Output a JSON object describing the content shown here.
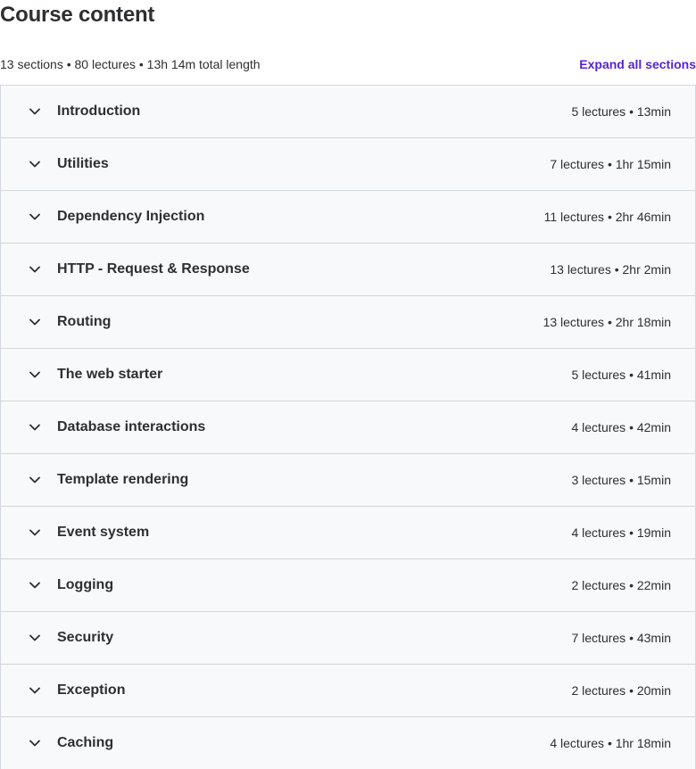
{
  "header": {
    "title": "Course content",
    "summary": "13 sections • 80 lectures • 13h 14m total length",
    "expand_all_label": "Expand all sections"
  },
  "icons": {
    "section_toggle": "chevron-down-icon"
  },
  "colors": {
    "accent": "#5624d0",
    "text": "#2d2f31",
    "row_background": "#f7f9fa",
    "border": "#d1d7dc"
  },
  "sections": [
    {
      "title": "Introduction",
      "info": "5 lectures • 13min"
    },
    {
      "title": "Utilities",
      "info": "7 lectures • 1hr 15min"
    },
    {
      "title": "Dependency Injection",
      "info": "11 lectures • 2hr 46min"
    },
    {
      "title": "HTTP - Request & Response",
      "info": "13 lectures • 2hr 2min"
    },
    {
      "title": "Routing",
      "info": "13 lectures • 2hr 18min"
    },
    {
      "title": "The web starter",
      "info": "5 lectures • 41min"
    },
    {
      "title": "Database interactions",
      "info": "4 lectures • 42min"
    },
    {
      "title": "Template rendering",
      "info": "3 lectures • 15min"
    },
    {
      "title": "Event system",
      "info": "4 lectures • 19min"
    },
    {
      "title": "Logging",
      "info": "2 lectures • 22min"
    },
    {
      "title": "Security",
      "info": "7 lectures • 43min"
    },
    {
      "title": "Exception",
      "info": "2 lectures • 20min"
    },
    {
      "title": "Caching",
      "info": "4 lectures • 1hr 18min"
    }
  ]
}
